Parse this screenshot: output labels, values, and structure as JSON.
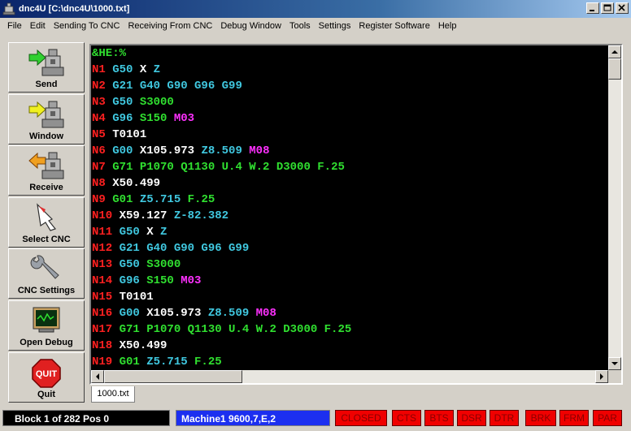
{
  "window": {
    "title": "dnc4U [C:\\dnc4U\\1000.txt]"
  },
  "menu": [
    "File",
    "Edit",
    "Sending To CNC",
    "Receiving From CNC",
    "Debug Window",
    "Tools",
    "Settings",
    "Register Software",
    "Help"
  ],
  "toolbar": {
    "send": "Send",
    "window": "Window",
    "receive": "Receive",
    "select_cnc": "Select CNC",
    "cnc_settings": "CNC Settings",
    "open_debug": "Open Debug",
    "quit": "Quit",
    "quit_icon_text": "QUIT"
  },
  "editor": {
    "lines": [
      [
        [
          "hdr",
          "&HE:%"
        ]
      ],
      [
        [
          "n",
          "N1 "
        ],
        [
          "g",
          "G50 "
        ],
        [
          "x",
          "X "
        ],
        [
          "z",
          "Z"
        ]
      ],
      [
        [
          "n",
          "N2 "
        ],
        [
          "g",
          "G21 G40 G90 G96 G99"
        ]
      ],
      [
        [
          "n",
          "N3 "
        ],
        [
          "g",
          "G50 "
        ],
        [
          "s",
          "S3000"
        ]
      ],
      [
        [
          "n",
          "N4 "
        ],
        [
          "g",
          "G96 "
        ],
        [
          "s",
          "S150 "
        ],
        [
          "m",
          "M03"
        ]
      ],
      [
        [
          "n",
          "N5 "
        ],
        [
          "t",
          "T0101"
        ]
      ],
      [
        [
          "n",
          "N6 "
        ],
        [
          "g",
          "G00 "
        ],
        [
          "x",
          "X105.973 "
        ],
        [
          "z",
          "Z8.509 "
        ],
        [
          "m",
          "M08"
        ]
      ],
      [
        [
          "n",
          "N7 "
        ],
        [
          "s",
          "G71 P1070 Q1130 U.4 W.2 D3000 F.25"
        ]
      ],
      [
        [
          "n",
          "N8 "
        ],
        [
          "x",
          "X50.499"
        ]
      ],
      [
        [
          "n",
          "N9 "
        ],
        [
          "s",
          "G01 "
        ],
        [
          "z",
          "Z5.715 "
        ],
        [
          "s",
          "F.25"
        ]
      ],
      [
        [
          "n",
          "N10 "
        ],
        [
          "x",
          "X59.127 "
        ],
        [
          "z",
          "Z-82.382"
        ]
      ],
      [
        [
          "n",
          "N11 "
        ],
        [
          "g",
          "G50 "
        ],
        [
          "x",
          "X "
        ],
        [
          "z",
          "Z"
        ]
      ],
      [
        [
          "n",
          "N12 "
        ],
        [
          "g",
          "G21 G40 G90 G96 G99"
        ]
      ],
      [
        [
          "n",
          "N13 "
        ],
        [
          "g",
          "G50 "
        ],
        [
          "s",
          "S3000"
        ]
      ],
      [
        [
          "n",
          "N14 "
        ],
        [
          "g",
          "G96 "
        ],
        [
          "s",
          "S150 "
        ],
        [
          "m",
          "M03"
        ]
      ],
      [
        [
          "n",
          "N15 "
        ],
        [
          "t",
          "T0101"
        ]
      ],
      [
        [
          "n",
          "N16 "
        ],
        [
          "g",
          "G00 "
        ],
        [
          "x",
          "X105.973 "
        ],
        [
          "z",
          "Z8.509 "
        ],
        [
          "m",
          "M08"
        ]
      ],
      [
        [
          "n",
          "N17 "
        ],
        [
          "s",
          "G71 P1070 Q1130 U.4 W.2 D3000 F.25"
        ]
      ],
      [
        [
          "n",
          "N18 "
        ],
        [
          "x",
          "X50.499"
        ]
      ],
      [
        [
          "n",
          "N19 "
        ],
        [
          "s",
          "G01 "
        ],
        [
          "z",
          "Z5.715 "
        ],
        [
          "s",
          "F.25"
        ]
      ]
    ]
  },
  "file_tab": "1000.txt",
  "status": {
    "block": "Block 1 of 282 Pos 0",
    "machine": "Machine1 9600,7,E,2",
    "flags": [
      "CLOSED",
      "CTS",
      "BTS",
      "DSR",
      "DTR",
      "BRK",
      "FRM",
      "PAR"
    ]
  },
  "colors": {
    "editor_bg": "#000000",
    "status_flag": "#f00000",
    "machine_bg": "#1c2ff0"
  }
}
